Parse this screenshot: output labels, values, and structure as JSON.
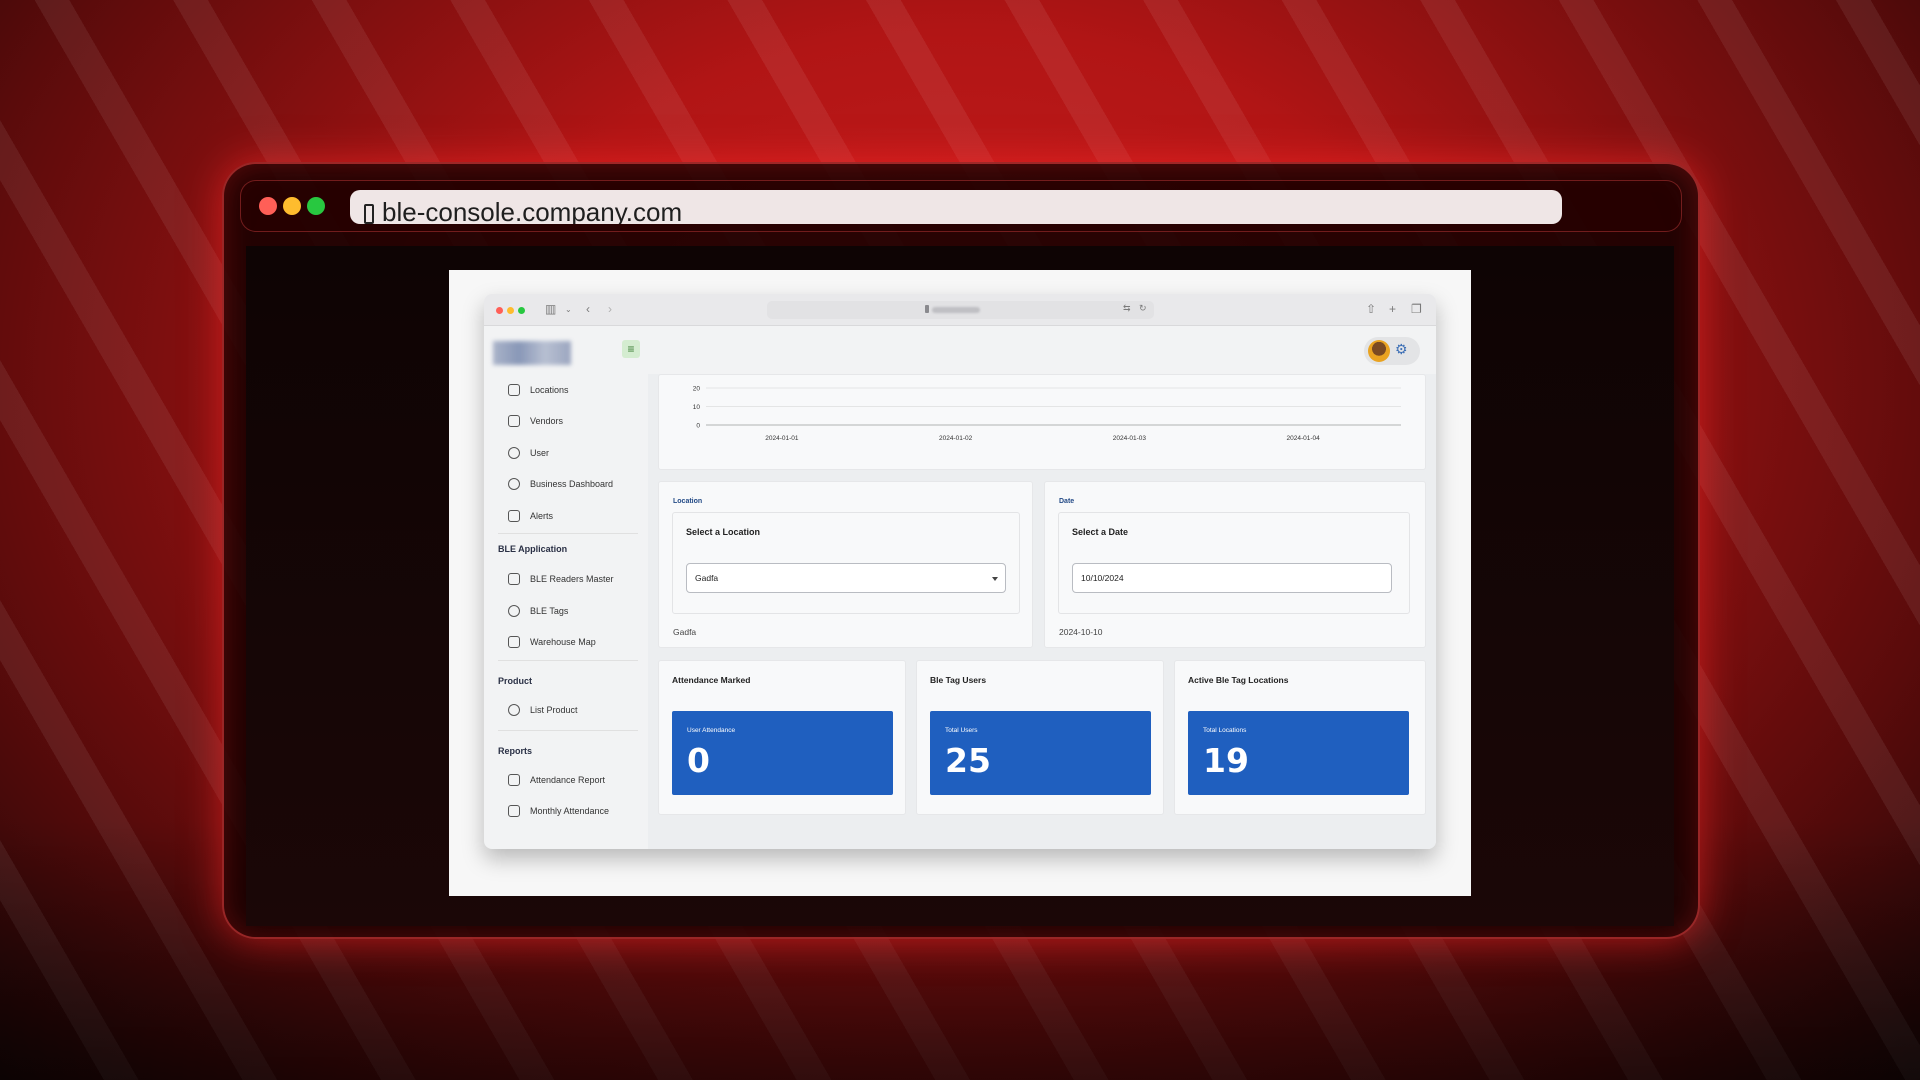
{
  "outer_browser": {
    "url": "ble-console.company.com",
    "colors": {
      "close": "#ff5f57",
      "minimize": "#febc2e",
      "zoom": "#28c840",
      "glow": "#ff3b3b"
    }
  },
  "sidebar": {
    "items": [
      {
        "label": "Locations",
        "icon": "home-icon"
      },
      {
        "label": "Vendors",
        "icon": "grid-icon"
      },
      {
        "label": "User",
        "icon": "users-icon"
      },
      {
        "label": "Business Dashboard",
        "icon": "radar-icon"
      },
      {
        "label": "Alerts",
        "icon": "clipboard-icon"
      }
    ],
    "sections": [
      {
        "title": "BLE Application",
        "items": [
          {
            "label": "BLE Readers Master",
            "icon": "antenna-icon"
          },
          {
            "label": "BLE Tags",
            "icon": "bluetooth-icon"
          },
          {
            "label": "Warehouse Map",
            "icon": "map-icon"
          }
        ]
      },
      {
        "title": "Product",
        "items": [
          {
            "label": "List Product",
            "icon": "boxes-icon"
          }
        ]
      },
      {
        "title": "Reports",
        "items": [
          {
            "label": "Attendance Report",
            "icon": "document-icon"
          },
          {
            "label": "Monthly Attendance",
            "icon": "document-icon"
          }
        ]
      }
    ]
  },
  "chart_data": {
    "type": "line",
    "x": [
      "2024-01-01",
      "2024-01-02",
      "2024-01-03",
      "2024-01-04"
    ],
    "yticks": [
      "20",
      "10",
      "0"
    ],
    "ylim": [
      0,
      20
    ],
    "series": [],
    "grid": true
  },
  "filters": {
    "location": {
      "label": "Location",
      "title": "Select a Location",
      "selected": "Gadfa",
      "echo": "Gadfa"
    },
    "date": {
      "label": "Date",
      "title": "Select a Date",
      "value": "10/10/2024",
      "echo": "2024-10-10"
    }
  },
  "stats": [
    {
      "title": "Attendance Marked",
      "label": "User Attendance",
      "value": "0"
    },
    {
      "title": "Ble Tag Users",
      "label": "Total Users",
      "value": "25"
    },
    {
      "title": "Active Ble Tag Locations",
      "label": "Total Locations",
      "value": "19"
    }
  ],
  "colors": {
    "accent": "#1f5fbf",
    "menu_button": "#d4ecd0"
  }
}
